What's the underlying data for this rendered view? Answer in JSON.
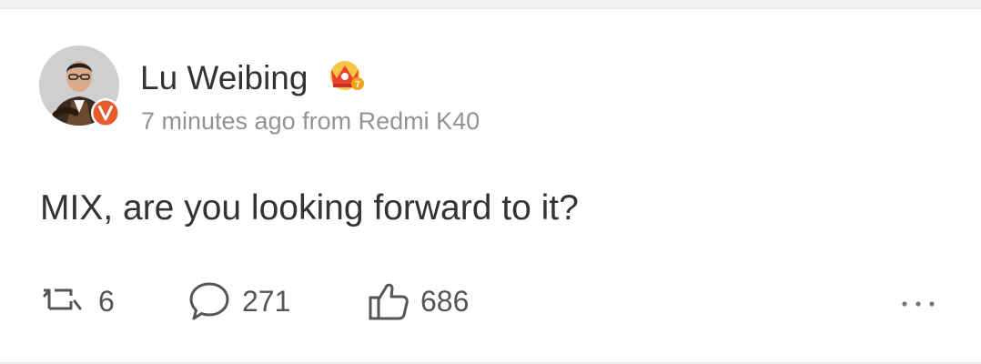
{
  "post": {
    "author": {
      "name": "Lu Weibing",
      "avatar_icon": "user-avatar",
      "verified_icon": "verified-v-badge-icon",
      "verified_color": "#e85c2b",
      "member_badge_icon": "crown-badge-icon",
      "member_badge_level": "7",
      "member_badge_color": "#f2a31c"
    },
    "meta": "7 minutes ago from Redmi K40",
    "text": "MIX, are you looking forward to it?",
    "actions": {
      "reposts": "6",
      "comments": "271",
      "likes": "686",
      "repost_icon": "repost-icon",
      "comment_icon": "comment-icon",
      "like_icon": "thumbs-up-icon",
      "more_icon": "more-dots-icon"
    }
  }
}
